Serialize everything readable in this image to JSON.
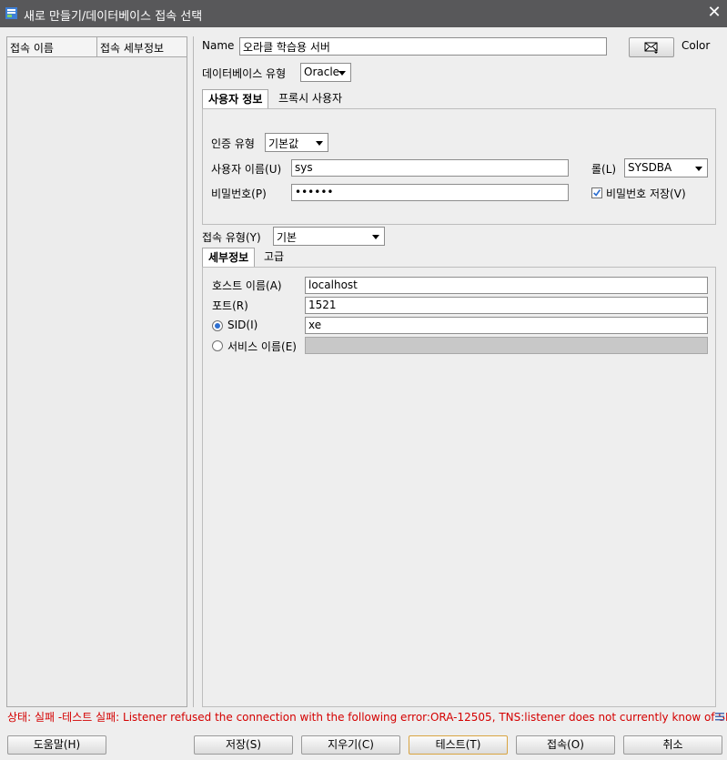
{
  "window": {
    "title": "새로 만들기/데이터베이스 접속 선택",
    "close_glyph": "✕"
  },
  "left_panel": {
    "columns": [
      "접속 이름",
      "접속 세부정보"
    ]
  },
  "connection": {
    "name_label": "Name",
    "name_value": "오라클 학습용 서버",
    "color_label": "Color",
    "db_type_label": "데이터베이스 유형",
    "db_type_value": "Oracle"
  },
  "user_tabs": [
    {
      "label": "사용자 정보",
      "active": true
    },
    {
      "label": "프록시 사용자",
      "active": false
    }
  ],
  "user_info": {
    "auth_type_label": "인증 유형",
    "auth_type_value": "기본값",
    "username_label": "사용자 이름(U)",
    "username_value": "sys",
    "role_label": "롤(L)",
    "role_value": "SYSDBA",
    "password_label": "비밀번호(P)",
    "password_value": "••••••",
    "save_password_label": "비밀번호 저장(V)",
    "save_password_checked": true
  },
  "conn_type": {
    "label": "접속 유형(Y)",
    "value": "기본"
  },
  "detail_tabs": [
    {
      "label": "세부정보",
      "active": true
    },
    {
      "label": "고급",
      "active": false
    }
  ],
  "details": {
    "host_label": "호스트 이름(A)",
    "host_value": "localhost",
    "port_label": "포트(R)",
    "port_value": "1521",
    "sid_label": "SID(I)",
    "sid_value": "xe",
    "service_label": "서비스 이름(E)",
    "service_value": ""
  },
  "status": {
    "text": "상태: 실패 -테스트 실패: Listener refused the connection with the following error:ORA-12505, TNS:listener does not currently know of SI..."
  },
  "buttons": {
    "help": "도움말(H)",
    "save": "저장(S)",
    "clear": "지우기(C)",
    "test": "테스트(T)",
    "connect": "접속(O)",
    "cancel": "취소"
  },
  "colors": {
    "titlebar": "#58585a",
    "status_error": "#d40000",
    "radio_accent": "#2e6fd0"
  }
}
